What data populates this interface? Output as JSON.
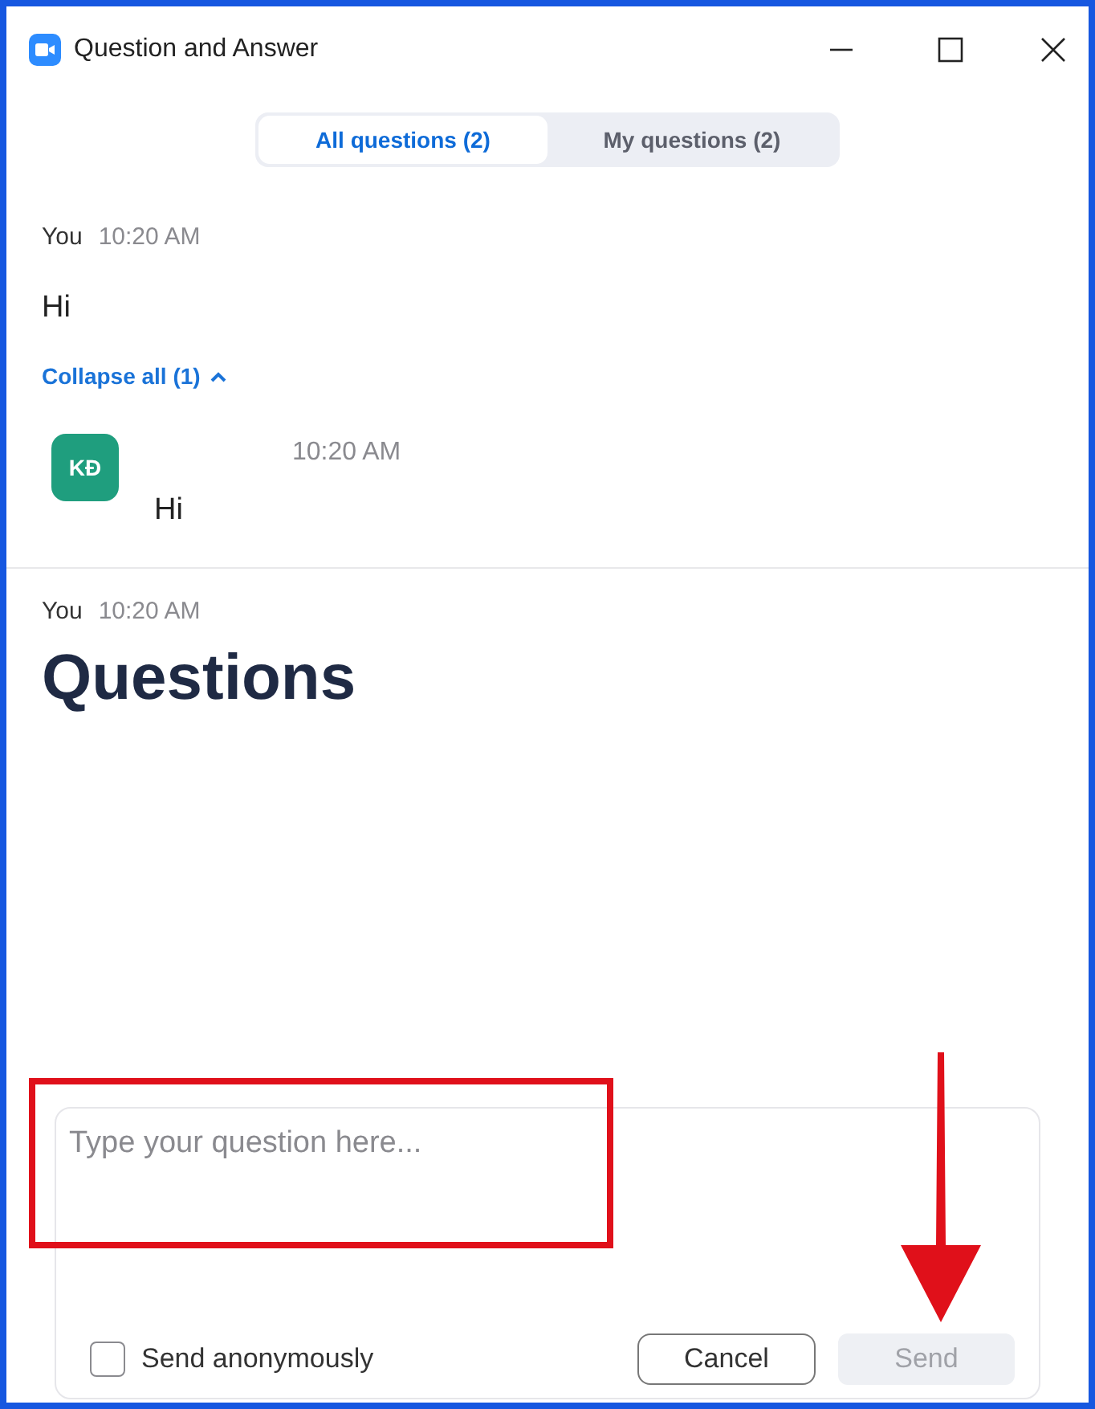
{
  "window": {
    "title": "Question and Answer"
  },
  "tabs": [
    {
      "label": "All questions (2)",
      "selected": true
    },
    {
      "label": "My questions (2)",
      "selected": false
    }
  ],
  "questions": [
    {
      "author": "You",
      "time": "10:20 AM",
      "text": "Hi",
      "collapse": {
        "label": "Collapse all (1)",
        "expanded": true
      },
      "replies": [
        {
          "initials": "KĐ",
          "color": "#1f9e7e",
          "time": "10:20 AM",
          "text": "Hi"
        }
      ]
    },
    {
      "author": "You",
      "time": "10:20 AM",
      "text": "Questions",
      "kind": "heading"
    }
  ],
  "composer": {
    "placeholder": "Type your question here...",
    "anonymous": {
      "label": "Send anonymously",
      "checked": false
    },
    "cancel": "Cancel",
    "send": {
      "label": "Send",
      "disabled": true
    }
  }
}
